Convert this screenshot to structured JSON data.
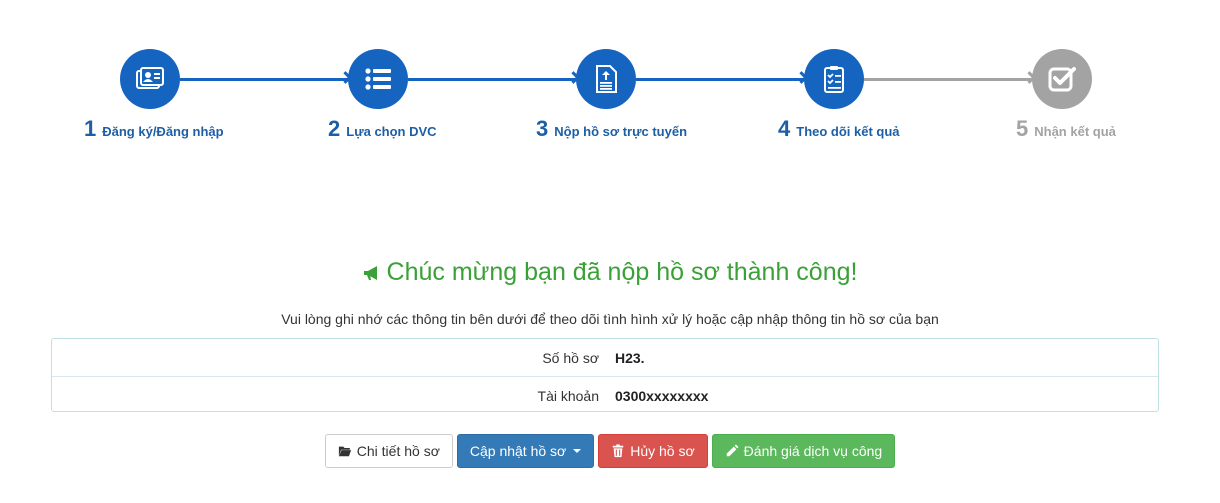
{
  "stepper": {
    "steps": [
      {
        "number": "1",
        "label": "Đăng ký/Đăng nhập",
        "icon": "id-card-icon",
        "status": "done"
      },
      {
        "number": "2",
        "label": "Lựa chọn DVC",
        "icon": "list-icon",
        "status": "done"
      },
      {
        "number": "3",
        "label": "Nộp hồ sơ trực tuyến",
        "icon": "document-upload-icon",
        "status": "done"
      },
      {
        "number": "4",
        "label": "Theo dõi kết quả",
        "icon": "clipboard-check-icon",
        "status": "done"
      },
      {
        "number": "5",
        "label": "Nhận kết quả",
        "icon": "check-square-icon",
        "status": "pending"
      }
    ]
  },
  "success": {
    "title": "Chúc mừng bạn đã nộp hồ sơ thành công!",
    "subtitle": "Vui lòng ghi nhớ các thông tin bên dưới để theo dõi tình hình xử lý hoặc cập nhập thông tin hồ sơ của bạn"
  },
  "info": {
    "rows": [
      {
        "label": "Số hồ sơ",
        "value": "H23."
      },
      {
        "label": "Tài khoản",
        "value": "0300xxxxxxxx"
      }
    ]
  },
  "actions": {
    "detail": "Chi tiết hồ sơ",
    "update": "Cập nhật hồ sơ",
    "cancel": "Hủy hồ sơ",
    "rate": "Đánh giá dịch vụ công"
  },
  "colors": {
    "primary": "#1565c0",
    "inactive": "#a3a3a3",
    "success_text": "#3aa137",
    "btn_primary": "#337ab7",
    "btn_danger": "#d9534f",
    "btn_success": "#5cb85c"
  }
}
